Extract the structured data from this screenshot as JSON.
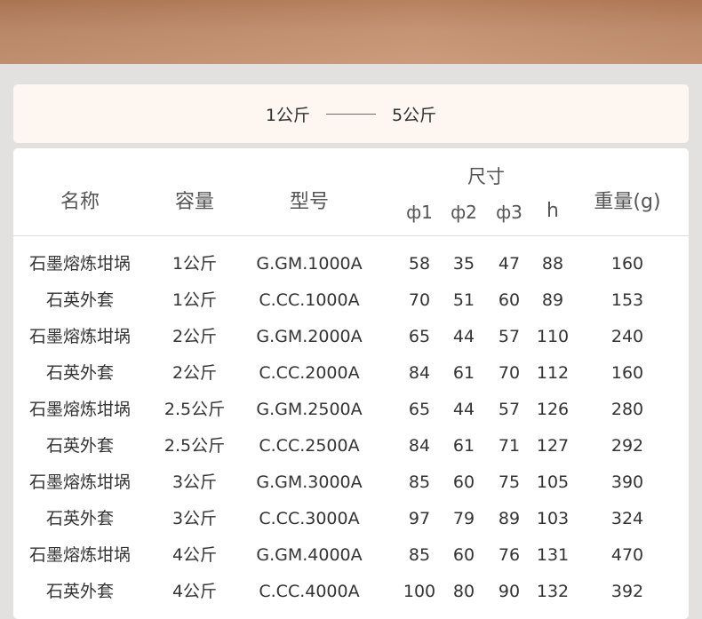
{
  "range": {
    "from": "1公斤",
    "to": "5公斤"
  },
  "table": {
    "headers": {
      "name": "名称",
      "capacity": "容量",
      "model": "型号",
      "size": "尺寸",
      "phi1": "ф1",
      "phi2": "ф2",
      "phi3": "ф3",
      "h": "h",
      "weight": "重量(g)"
    },
    "rows": [
      {
        "name": "石墨熔炼坩埚",
        "capacity": "1公斤",
        "model": "G.GM.1000A",
        "phi1": "58",
        "phi2": "35",
        "phi3": "47",
        "h": "88",
        "weight": "160"
      },
      {
        "name": "石英外套",
        "capacity": "1公斤",
        "model": "C.CC.1000A",
        "phi1": "70",
        "phi2": "51",
        "phi3": "60",
        "h": "89",
        "weight": "153"
      },
      {
        "name": "石墨熔炼坩埚",
        "capacity": "2公斤",
        "model": "G.GM.2000A",
        "phi1": "65",
        "phi2": "44",
        "phi3": "57",
        "h": "110",
        "weight": "240"
      },
      {
        "name": "石英外套",
        "capacity": "2公斤",
        "model": "C.CC.2000A",
        "phi1": "84",
        "phi2": "61",
        "phi3": "70",
        "h": "112",
        "weight": "160"
      },
      {
        "name": "石墨熔炼坩埚",
        "capacity": "2.5公斤",
        "model": "G.GM.2500A",
        "phi1": "65",
        "phi2": "44",
        "phi3": "57",
        "h": "126",
        "weight": "280"
      },
      {
        "name": "石英外套",
        "capacity": "2.5公斤",
        "model": "C.CC.2500A",
        "phi1": "84",
        "phi2": "61",
        "phi3": "71",
        "h": "127",
        "weight": "292"
      },
      {
        "name": "石墨熔炼坩埚",
        "capacity": "3公斤",
        "model": "G.GM.3000A",
        "phi1": "85",
        "phi2": "60",
        "phi3": "75",
        "h": "105",
        "weight": "390"
      },
      {
        "name": "石英外套",
        "capacity": "3公斤",
        "model": "C.CC.3000A",
        "phi1": "97",
        "phi2": "79",
        "phi3": "89",
        "h": "103",
        "weight": "324"
      },
      {
        "name": "石墨熔炼坩埚",
        "capacity": "4公斤",
        "model": "G.GM.4000A",
        "phi1": "85",
        "phi2": "60",
        "phi3": "76",
        "h": "131",
        "weight": "470"
      },
      {
        "name": "石英外套",
        "capacity": "4公斤",
        "model": "C.CC.4000A",
        "phi1": "100",
        "phi2": "80",
        "phi3": "90",
        "h": "132",
        "weight": "392"
      }
    ]
  }
}
